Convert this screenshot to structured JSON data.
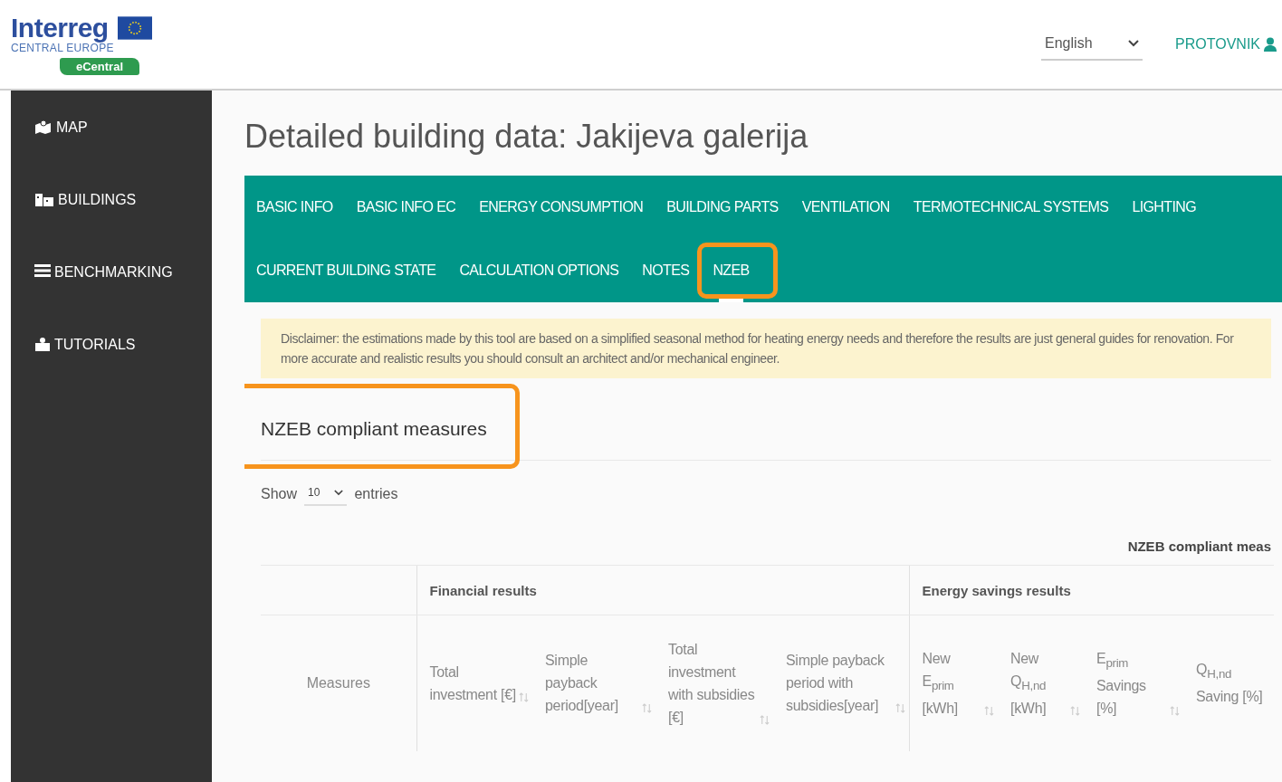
{
  "header": {
    "logo": {
      "title": "Interreg",
      "subtitle": "CENTRAL EUROPE",
      "badge": "eCentral"
    },
    "language": "English",
    "user": "PROTOVNIK"
  },
  "sidebar": {
    "items": [
      {
        "label": "MAP",
        "kind": "map"
      },
      {
        "label": "BUILDINGS",
        "kind": "buildings"
      },
      {
        "label": "BENCHMARKING",
        "kind": "list"
      },
      {
        "label": "TUTORIALS",
        "kind": "tutorials"
      }
    ]
  },
  "title": "Detailed building data: Jakijeva galerija",
  "tabs": [
    {
      "label": "BASIC INFO",
      "selected": false,
      "highlighted": false
    },
    {
      "label": "BASIC INFO EC",
      "selected": false,
      "highlighted": false
    },
    {
      "label": "ENERGY CONSUMPTION",
      "selected": false,
      "highlighted": false
    },
    {
      "label": "BUILDING PARTS",
      "selected": false,
      "highlighted": false
    },
    {
      "label": "VENTILATION",
      "selected": false,
      "highlighted": false
    },
    {
      "label": "TERMOTECHNICAL SYSTEMS",
      "selected": false,
      "highlighted": false
    },
    {
      "label": "LIGHTING",
      "selected": false,
      "highlighted": false
    },
    {
      "label": "CURRENT BUILDING STATE",
      "selected": false,
      "highlighted": false
    },
    {
      "label": "CALCULATION OPTIONS",
      "selected": false,
      "highlighted": false
    },
    {
      "label": "NOTES",
      "selected": false,
      "highlighted": false
    },
    {
      "label": "NZEB",
      "selected": true,
      "highlighted": true
    }
  ],
  "disclaimer": "Disclaimer: the estimations made by this tool are based on a simplified seasonal method for heating energy needs and therefore the results are just general guides for renovation. For more accurate and realistic results you should consult an architect and/or mechanical engineer.",
  "section": {
    "heading": "NZEB compliant measures",
    "highlighted": true
  },
  "length_control": {
    "before": "Show",
    "value": "10",
    "after": "entries"
  },
  "table": {
    "caption": "NZEB compliant meas",
    "first_column": "Measures",
    "groups": [
      {
        "label": "Financial results",
        "columns": [
          "Total investment [€]",
          "Simple payback period[year]",
          "Total investment with subsidies [€]",
          "Simple payback period with subsidies[year]"
        ]
      },
      {
        "label": "Energy savings results",
        "columns": [
          "New E$_{prim}$ [kWh]",
          "New Q$_{H,nd}$ [kWh]",
          "E$_{prim}$ Savings [%]",
          "Q$_{H,nd}$ Saving [%]"
        ]
      }
    ]
  }
}
